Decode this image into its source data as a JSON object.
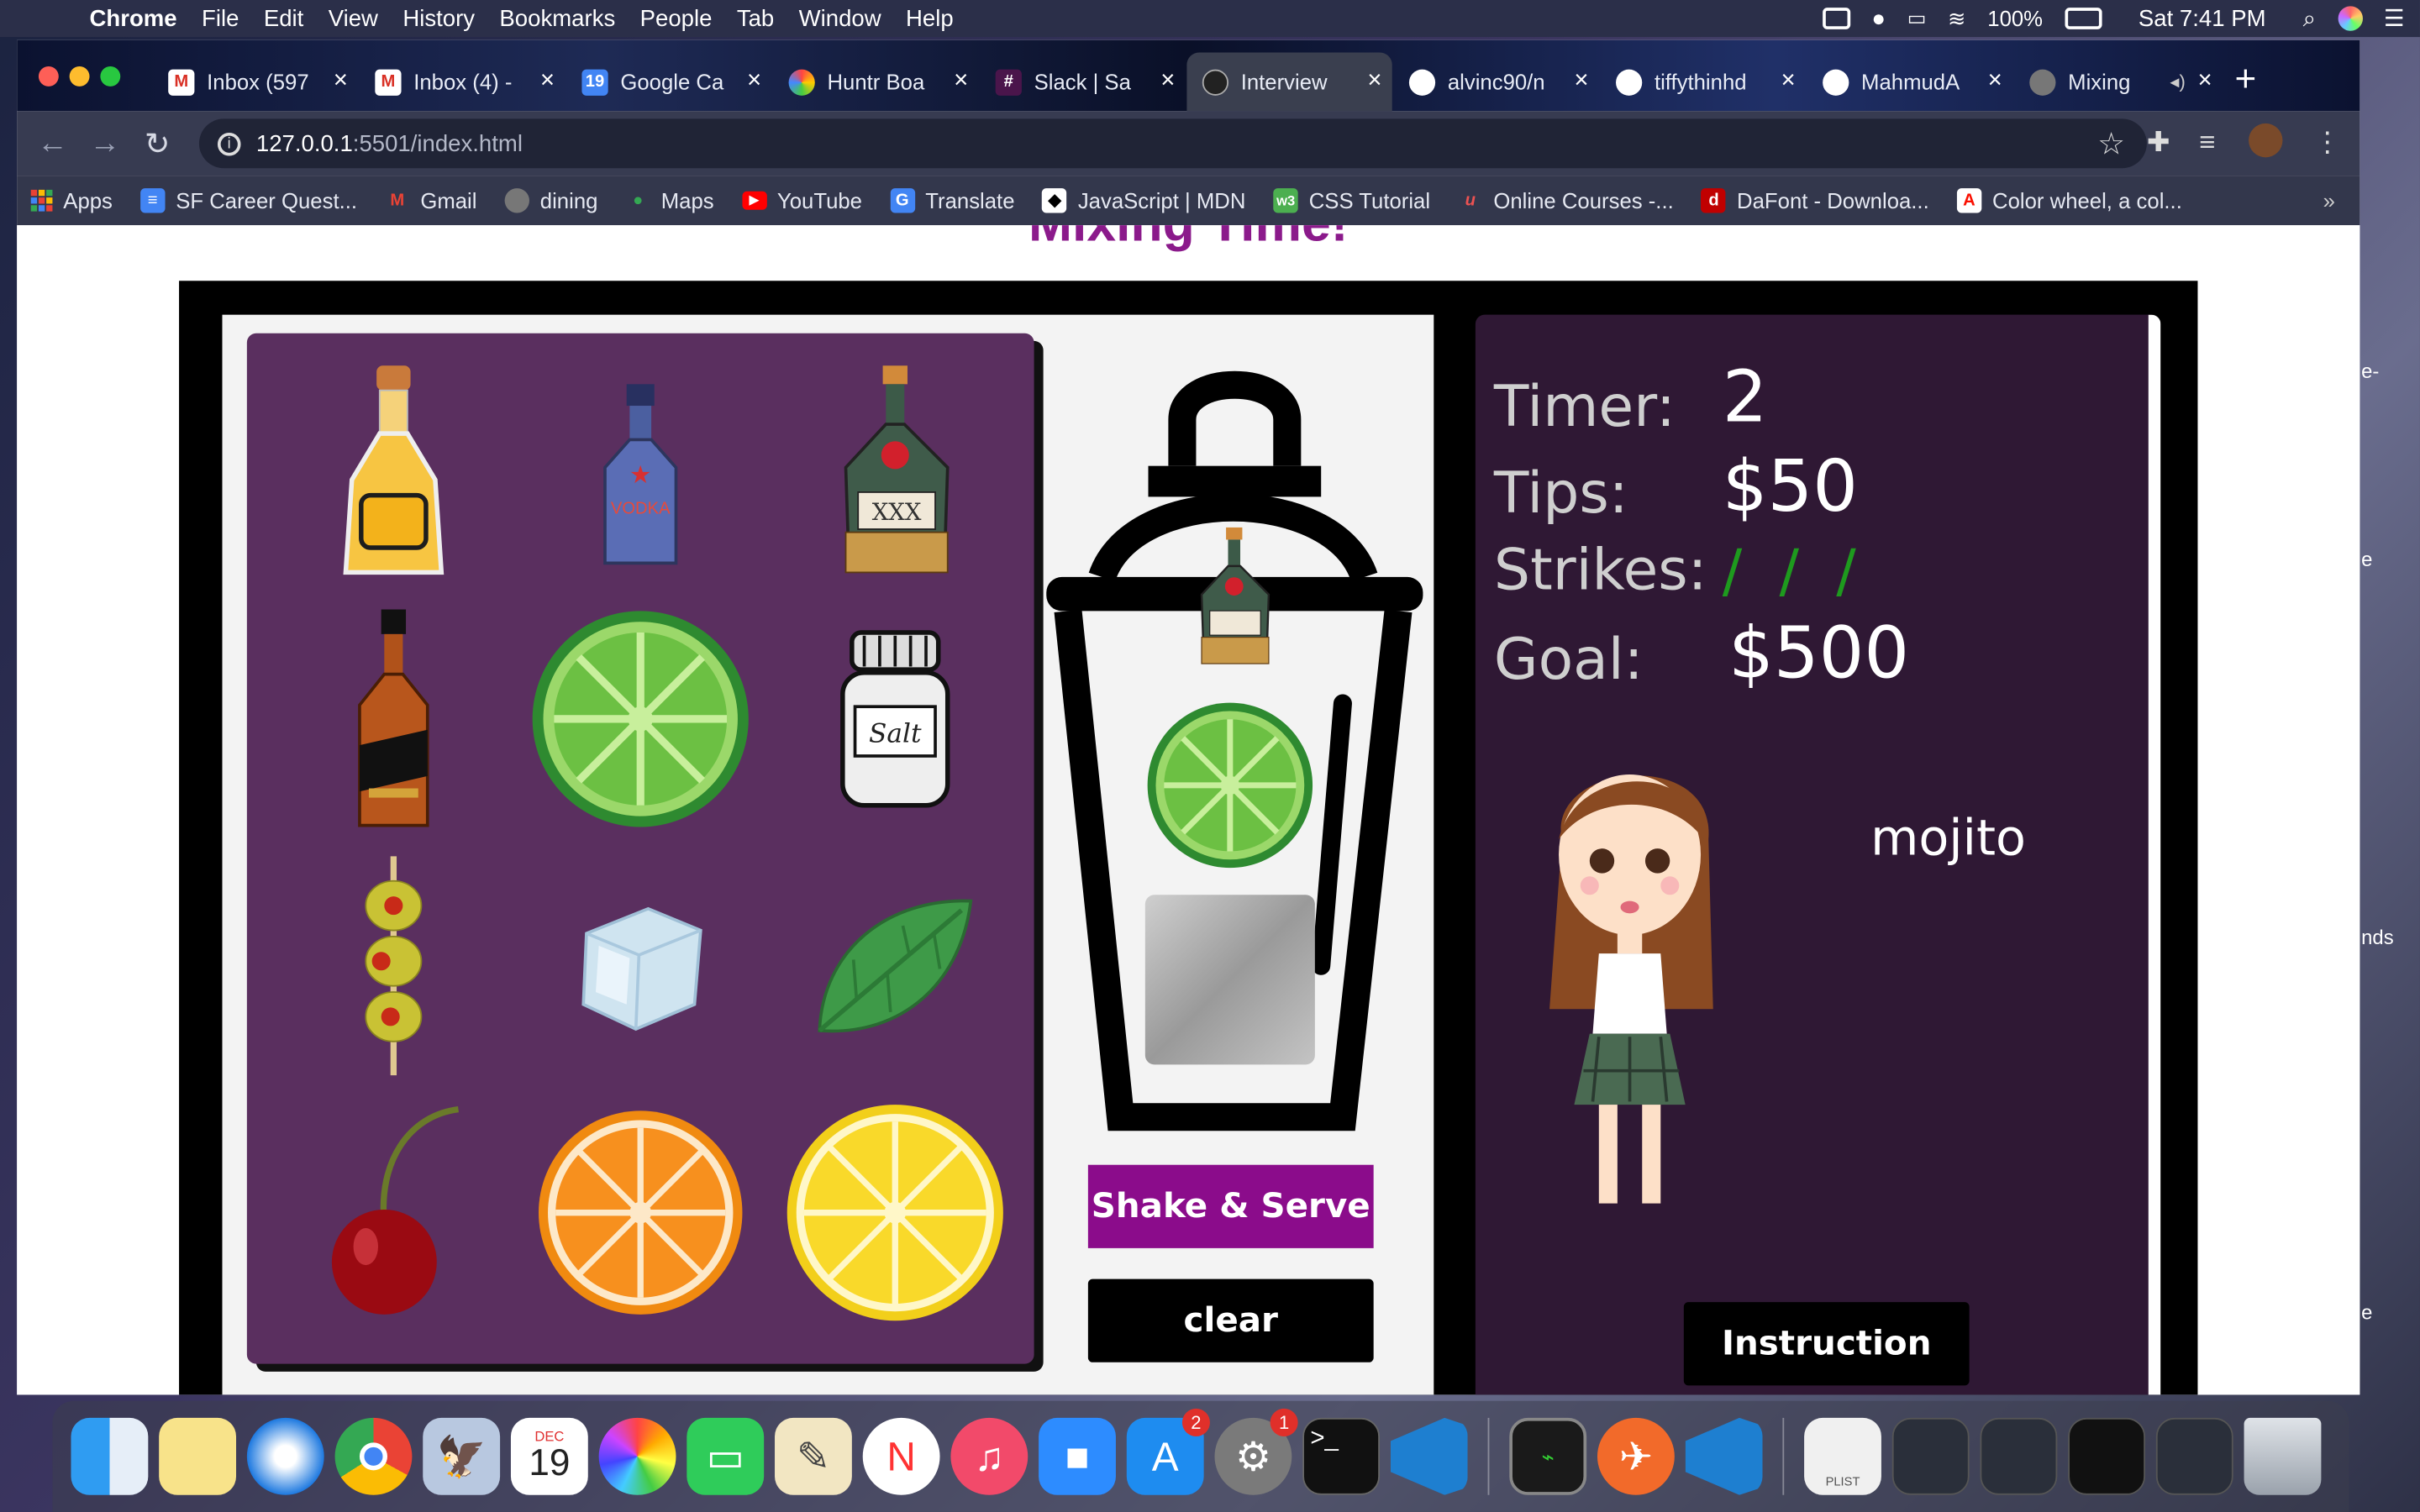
{
  "menubar": {
    "app": "Chrome",
    "items": [
      "File",
      "Edit",
      "View",
      "History",
      "Bookmarks",
      "People",
      "Tab",
      "Window",
      "Help"
    ],
    "battery": "100%",
    "clock": "Sat 7:41 PM"
  },
  "tabs": [
    {
      "label": "Inbox (597",
      "icon": "gmail-icon"
    },
    {
      "label": "Inbox (4) -",
      "icon": "gmail-icon"
    },
    {
      "label": "Google Ca",
      "icon": "calendar-icon"
    },
    {
      "label": "Huntr Boa",
      "icon": "huntr-icon"
    },
    {
      "label": "Slack | Sa",
      "icon": "slack-icon"
    },
    {
      "label": "Interview",
      "icon": "interview-icon"
    },
    {
      "label": "alvinc90/n",
      "icon": "github-icon"
    },
    {
      "label": "tiffythinhd",
      "icon": "github-icon"
    },
    {
      "label": "MahmudA",
      "icon": "github-icon"
    },
    {
      "label": "Mixing",
      "icon": "globe-icon"
    }
  ],
  "address": {
    "host": "127.0.0.1",
    "rest": ":5501/index.html"
  },
  "bookmarks": [
    {
      "label": "Apps",
      "color": "#e94235"
    },
    {
      "label": "SF Career Quest...",
      "color": "#4285f4"
    },
    {
      "label": "Gmail",
      "color": "#ea4335"
    },
    {
      "label": "dining",
      "color": "#777777"
    },
    {
      "label": "Maps",
      "color": "#34a853"
    },
    {
      "label": "YouTube",
      "color": "#ff0000"
    },
    {
      "label": "Translate",
      "color": "#4285f4"
    },
    {
      "label": "JavaScript | MDN",
      "color": "#000000"
    },
    {
      "label": "CSS Tutorial",
      "color": "#4caf50"
    },
    {
      "label": "Online Courses -...",
      "color": "#ec5252"
    },
    {
      "label": "DaFont - Downloa...",
      "color": "#c00000"
    },
    {
      "label": "Color wheel, a col...",
      "color": "#fa0f00"
    }
  ],
  "game": {
    "title": "Mixing Time!",
    "ingredients": [
      "tequila",
      "vodka",
      "rum",
      "whiskey",
      "lime",
      "salt",
      "olives",
      "ice",
      "mint",
      "cherry",
      "orange",
      "lemon"
    ],
    "vodka_label": "VODKA",
    "rum_label": "XXX",
    "salt_label": "Salt",
    "shake_button": "Shake & Serve",
    "clear_button": "clear",
    "stats": {
      "timer_label": "Timer:",
      "timer_value": "2",
      "tips_label": "Tips:",
      "tips_value": "$50",
      "strikes_label": "Strikes:",
      "strikes_value": "/ / /",
      "goal_label": "Goal:",
      "goal_value": "$500"
    },
    "order": "mojito",
    "instruction_button": "Instruction"
  },
  "desktop_fragments": [
    "e-",
    "e",
    "nds",
    "e"
  ],
  "dock": {
    "calendar_month": "DEC",
    "calendar_day": "19",
    "appstore_badge": "2",
    "settings_badge": "1",
    "plist_label": "PLIST"
  }
}
